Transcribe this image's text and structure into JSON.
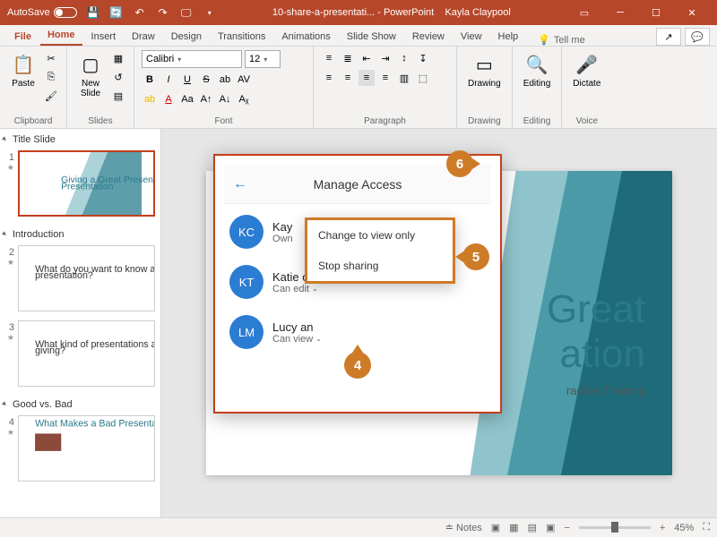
{
  "titlebar": {
    "autosave": "AutoSave",
    "doc": "10-share-a-presentati... - PowerPoint",
    "user": "Kayla Claypool"
  },
  "tabs": [
    "File",
    "Home",
    "Insert",
    "Draw",
    "Design",
    "Transitions",
    "Animations",
    "Slide Show",
    "Review",
    "View",
    "Help"
  ],
  "tellme": "Tell me",
  "ribbon": {
    "clipboard": {
      "label": "Clipboard",
      "paste": "Paste"
    },
    "slides": {
      "label": "Slides",
      "new": "New\nSlide"
    },
    "font": {
      "label": "Font",
      "name": "Calibri",
      "size": "12"
    },
    "paragraph": {
      "label": "Paragraph"
    },
    "drawing": {
      "label": "Drawing",
      "btn": "Drawing"
    },
    "editing": {
      "label": "Editing",
      "btn": "Editing"
    },
    "voice": {
      "label": "Voice",
      "btn": "Dictate"
    }
  },
  "sections": [
    "Title Slide",
    "Introduction",
    "Good vs. Bad"
  ],
  "thumbs": {
    "t1": "Giving a Great Presentation",
    "t2": "What do you want to know after today's presentation?",
    "t3": "What kind of presentations are you giving?",
    "t4": "What Makes a Bad Presentation?"
  },
  "slide_text": {
    "title": "Great",
    "sub": "ation",
    "tag": "ractive Training"
  },
  "modal": {
    "title": "Manage Access",
    "p1": {
      "init": "KC",
      "name": "Kay",
      "role": "Own"
    },
    "p2": {
      "init": "KT",
      "name": "Katie       omas",
      "role": "Can edit"
    },
    "p3": {
      "init": "LM",
      "name": "Lucy       an",
      "role": "Can view"
    }
  },
  "menu": {
    "i1": "Change to view only",
    "i2": "Stop sharing"
  },
  "badges": {
    "b4": "4",
    "b5": "5",
    "b6": "6"
  },
  "statusbar": {
    "notes": "Notes",
    "zoom": "45%"
  }
}
